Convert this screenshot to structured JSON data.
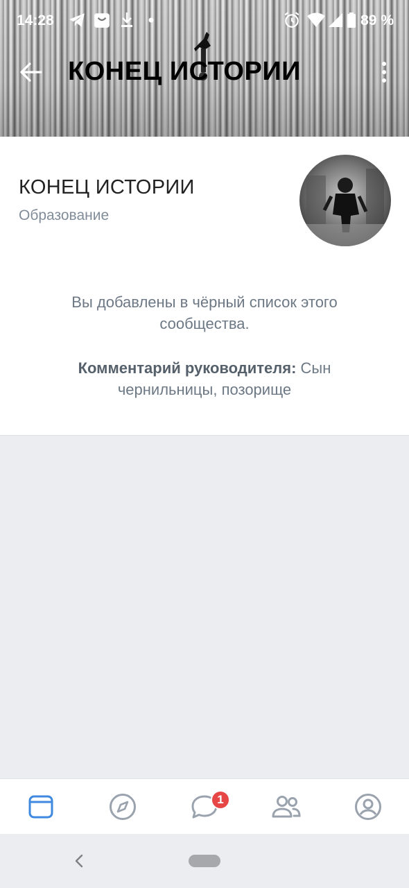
{
  "status_bar": {
    "time": "14:28",
    "battery": "89 %"
  },
  "header": {
    "title": "КОНЕЦ ИСТОРИИ"
  },
  "group": {
    "name": "КОНЕЦ ИСТОРИИ",
    "category": "Образование"
  },
  "blocked": {
    "message": "Вы добавлены в чёрный список этого сообщества.",
    "comment_label": "Комментарий руководителя:",
    "comment_text": " Сын чернильницы, позорище"
  },
  "tabbar": {
    "messages_badge": "1"
  },
  "colors": {
    "accent": "#3f8ae0",
    "icon_inactive": "#99a2ad",
    "badge": "#e64646"
  }
}
